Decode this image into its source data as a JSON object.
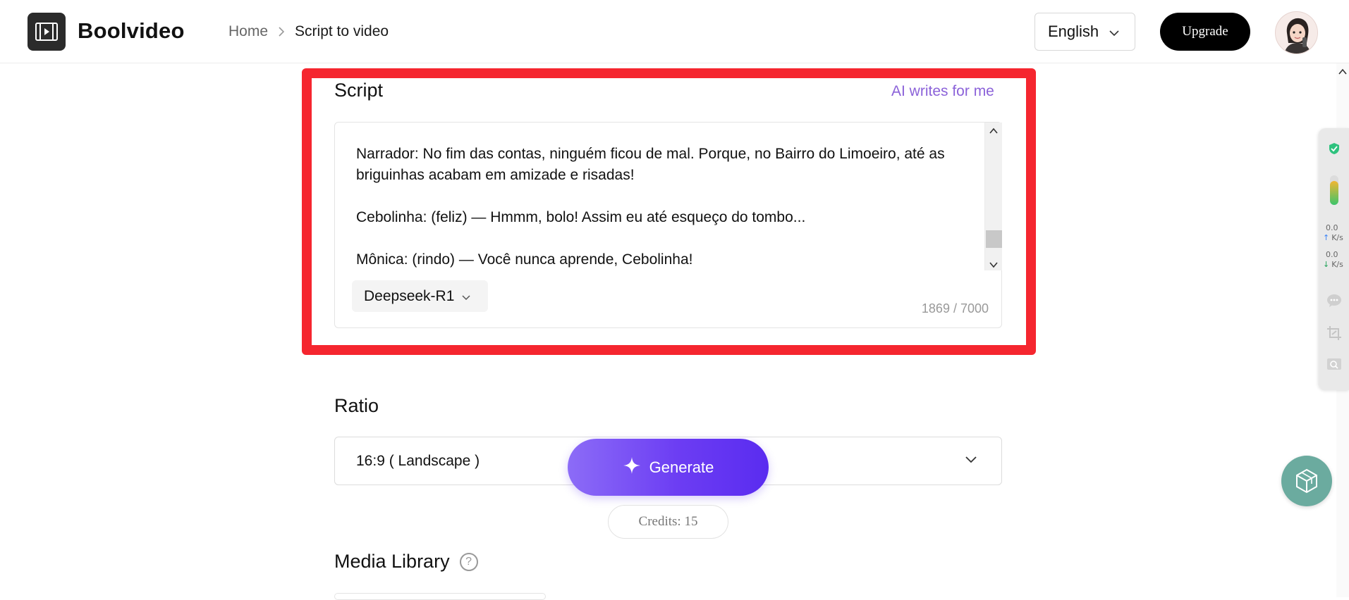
{
  "app": {
    "brand": "Boolvideo"
  },
  "breadcrumb": {
    "home": "Home",
    "current": "Script to video"
  },
  "header": {
    "language": "English",
    "upgrade_label": "Upgrade"
  },
  "script": {
    "title": "Script",
    "ai_writes_label": "AI writes for me",
    "lines": [
      "Narrador: No fim das contas, ninguém ficou de mal. Porque, no Bairro do Limoeiro, até as briguinhas acabam em amizade e risadas!",
      "Cebolinha: (feliz) — Hmmm, bolo! Assim eu até esqueço do tombo...",
      "Mônica: (rindo) — Você nunca aprende, Cebolinha!"
    ],
    "model": "Deepseek-R1",
    "char_count": "1869 / 7000",
    "scroll_fraction": 0.92
  },
  "ratio": {
    "title": "Ratio",
    "value": "16:9 ( Landscape )"
  },
  "generate": {
    "label": "Generate",
    "credits": "Credits: 15"
  },
  "media_library": {
    "title": "Media Library",
    "help": "?"
  },
  "side_panel": {
    "upload_speed_value": "0.0",
    "upload_speed_unit": "K/s",
    "download_speed_value": "0.0",
    "download_speed_unit": "K/s"
  },
  "colors": {
    "accent_purple": "#6c3df3",
    "ai_link": "#8b62d9",
    "highlight_red": "#f5262f",
    "fab_teal": "#6bab9f"
  }
}
